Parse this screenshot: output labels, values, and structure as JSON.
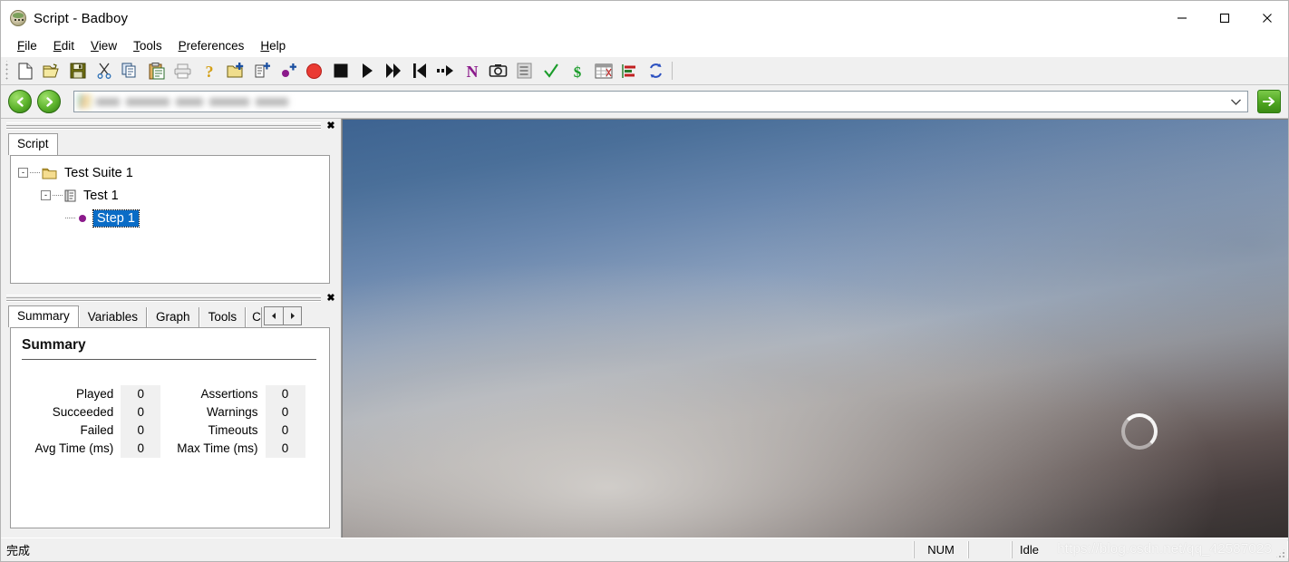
{
  "window": {
    "title": "Script - Badboy",
    "icon": "badboy-app-icon",
    "controls": [
      {
        "name": "minimize-button",
        "glyph": "minimize"
      },
      {
        "name": "maximize-button",
        "glyph": "maximize"
      },
      {
        "name": "close-button",
        "glyph": "close"
      }
    ]
  },
  "menu": {
    "items": [
      {
        "label": "File",
        "mnemonic": "F"
      },
      {
        "label": "Edit",
        "mnemonic": "E"
      },
      {
        "label": "View",
        "mnemonic": "V"
      },
      {
        "label": "Tools",
        "mnemonic": "T"
      },
      {
        "label": "Preferences",
        "mnemonic": "P"
      },
      {
        "label": "Help",
        "mnemonic": "H"
      }
    ]
  },
  "toolbar": {
    "buttons": [
      {
        "name": "new-file-icon",
        "title": "New"
      },
      {
        "name": "open-folder-icon",
        "title": "Open"
      },
      {
        "name": "save-disk-icon",
        "title": "Save"
      },
      {
        "name": "cut-scissors-icon",
        "title": "Cut"
      },
      {
        "name": "copy-icon",
        "title": "Copy"
      },
      {
        "name": "paste-clipboard-icon",
        "title": "Paste"
      },
      {
        "name": "print-icon",
        "title": "Print"
      },
      {
        "name": "help-question-icon",
        "title": "Help"
      },
      {
        "name": "add-suite-folder-icon",
        "title": "New Test Suite"
      },
      {
        "name": "add-test-icon",
        "title": "New Test"
      },
      {
        "name": "add-step-icon",
        "title": "New Step"
      },
      {
        "name": "record-icon",
        "title": "Record"
      },
      {
        "name": "stop-icon",
        "title": "Stop"
      },
      {
        "name": "play-icon",
        "title": "Play"
      },
      {
        "name": "play-all-icon",
        "title": "Play All"
      },
      {
        "name": "rewind-icon",
        "title": "Rewind"
      },
      {
        "name": "step-over-icon",
        "title": "Step"
      },
      {
        "name": "navigator-n-icon",
        "title": "Navigator"
      },
      {
        "name": "camera-snapshot-icon",
        "title": "Snapshot"
      },
      {
        "name": "report-icon",
        "title": "Report"
      },
      {
        "name": "assertion-check-icon",
        "title": "Assertion"
      },
      {
        "name": "variable-dollar-icon",
        "title": "Variable"
      },
      {
        "name": "grid-icon",
        "title": "Grid"
      },
      {
        "name": "chart-icon",
        "title": "Chart"
      },
      {
        "name": "refresh-icon",
        "title": "Refresh"
      }
    ]
  },
  "address": {
    "back_icon": "back-arrow-icon",
    "forward_icon": "forward-arrow-icon",
    "value": "",
    "placeholder": "",
    "redacted": true,
    "dropdown_icon": "chevron-down-icon",
    "go_icon": "go-arrow-icon"
  },
  "script_panel": {
    "close_label": "✖",
    "tabs": [
      {
        "label": "Script",
        "active": true
      }
    ],
    "tree": [
      {
        "label": "Test Suite 1",
        "level": 1,
        "icon": "folder-icon",
        "expander": "-",
        "selected": false
      },
      {
        "label": "Test 1",
        "level": 2,
        "icon": "test-document-icon",
        "expander": "-",
        "selected": false
      },
      {
        "label": "Step 1",
        "level": 3,
        "icon": "step-bullet-icon",
        "expander": "",
        "selected": true
      }
    ]
  },
  "summary_panel": {
    "close_label": "✖",
    "tabs": [
      {
        "label": "Summary",
        "active": true
      },
      {
        "label": "Variables",
        "active": false
      },
      {
        "label": "Graph",
        "active": false
      },
      {
        "label": "Tools",
        "active": false
      },
      {
        "label": "C",
        "active": false,
        "clipped": true
      }
    ],
    "scroll_left_icon": "scroll-left-icon",
    "scroll_right_icon": "scroll-right-icon",
    "heading": "Summary",
    "stats_left": [
      {
        "label": "Played",
        "value": "0"
      },
      {
        "label": "Succeeded",
        "value": "0"
      },
      {
        "label": "Failed",
        "value": "0"
      },
      {
        "label": "Avg Time (ms)",
        "value": "0"
      }
    ],
    "stats_right": [
      {
        "label": "Assertions",
        "value": "0"
      },
      {
        "label": "Warnings",
        "value": "0"
      },
      {
        "label": "Timeouts",
        "value": "0"
      },
      {
        "label": "Max Time (ms)",
        "value": "0"
      }
    ]
  },
  "browser": {
    "spinner_icon": "loading-spinner-icon",
    "page_state": "loading"
  },
  "statusbar": {
    "message": "完成",
    "num_lock": "NUM",
    "state": "Idle",
    "watermark": "https://blog.csdn.net/qq_42587023"
  },
  "colors": {
    "selection_blue": "#0a6cc6",
    "accent_green": "#4ea520",
    "record_red": "#e8312c",
    "navigator_purple": "#8b1a8b",
    "panel_bg": "#f0f0f0"
  }
}
